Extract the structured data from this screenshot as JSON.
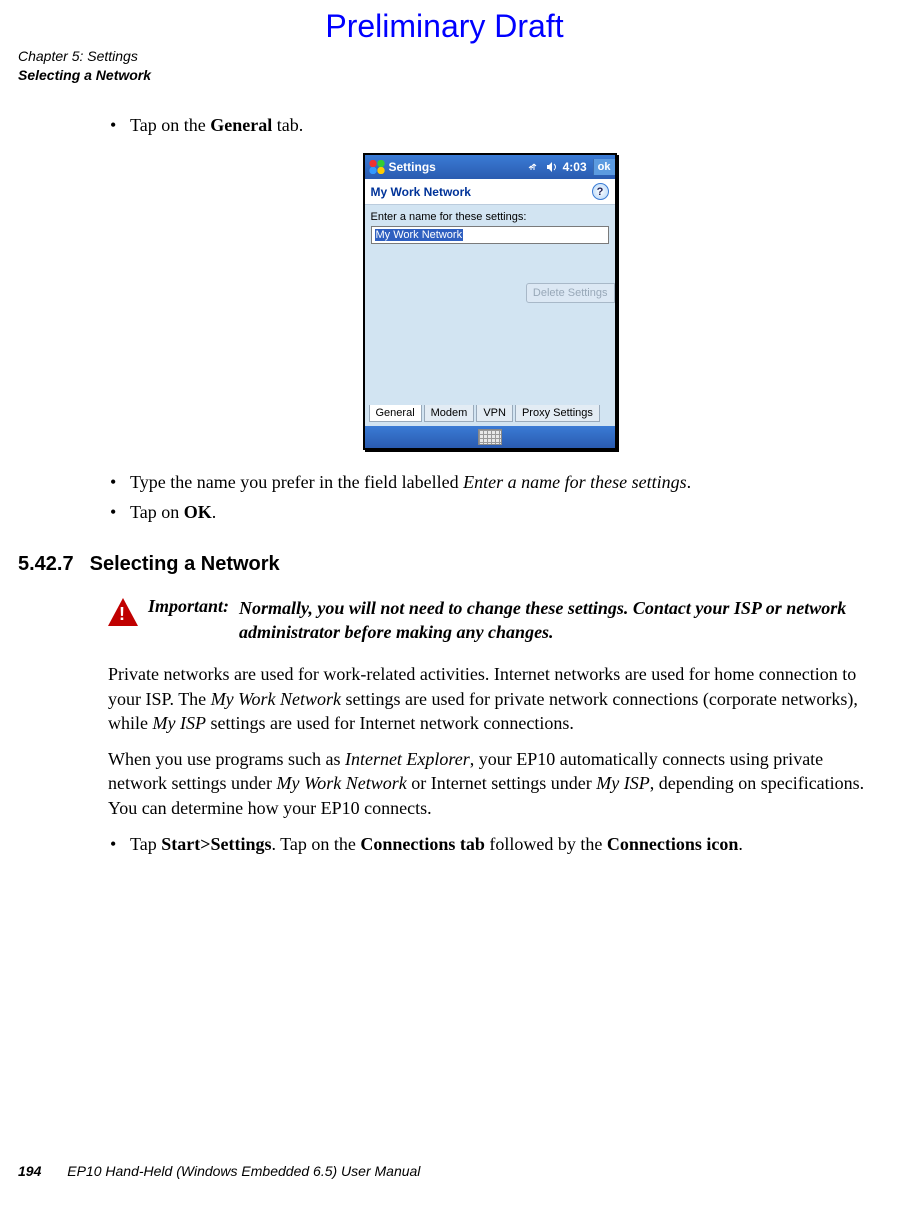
{
  "draft_header": "Preliminary Draft",
  "chapter": {
    "line1": "Chapter 5: Settings",
    "line2": "Selecting a Network"
  },
  "bullets1": {
    "b1_pre": "Tap on the ",
    "b1_bold": "General",
    "b1_post": " tab."
  },
  "device": {
    "title": "Settings",
    "time": "4:03",
    "ok": "ok",
    "subhead": "My Work Network",
    "help": "?",
    "label": "Enter a name for these settings:",
    "input": "My Work Network",
    "delete": "Delete Settings",
    "tabs": {
      "general": "General",
      "modem": "Modem",
      "vpn": "VPN",
      "proxy": "Proxy Settings"
    }
  },
  "bullets2": {
    "b2_pre": "Type the name you prefer in the field labelled ",
    "b2_italic": "Enter a name for these settings",
    "b2_post": ".",
    "b3_pre": "Tap on ",
    "b3_bold": "OK",
    "b3_post": "."
  },
  "section": {
    "num": "5.42.7",
    "title": "Selecting a Network"
  },
  "important": {
    "label": "Important:",
    "text": "Normally, you will not need to change these settings. Contact your ISP or network administrator before making any changes."
  },
  "p1": {
    "a": "Private networks are used for work-related activities. Internet networks are used for home connection to your ISP. The ",
    "i1": "My Work Network",
    "b": " settings are used for private network connec­tions (corporate networks), while ",
    "i2": "My ISP",
    "c": " settings are used for Internet network connections."
  },
  "p2": {
    "a": "When you use programs such as ",
    "i1": "Internet Explorer",
    "b": ", your EP10 automatically connects using private network settings under ",
    "i2": "My Work Network",
    "c": " or Internet settings under ",
    "i3": "My ISP",
    "d": ", depend­ing on specifications. You can determine how your EP10 connects."
  },
  "bullets3": {
    "pre": "Tap ",
    "b1": "Start>Settings",
    "mid1": ". Tap on the ",
    "b2": "Connections tab",
    "mid2": " followed by the ",
    "b3": "Connections icon",
    "post": "."
  },
  "footer": {
    "page": "194",
    "title": "EP10 Hand-Held (Windows Embedded 6.5) User Manual"
  }
}
